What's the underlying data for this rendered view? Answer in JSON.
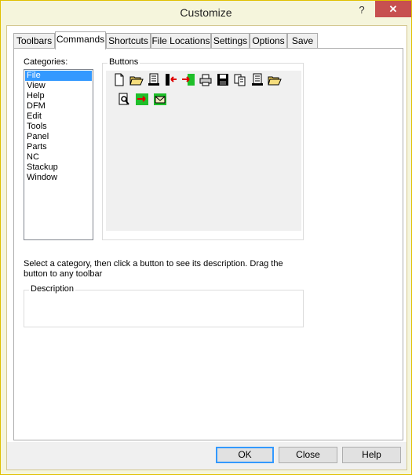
{
  "window": {
    "title": "Customize",
    "help_glyph": "?",
    "close_glyph": "✕"
  },
  "tabs": [
    {
      "label": "Toolbars"
    },
    {
      "label": "Commands",
      "active": true
    },
    {
      "label": "Shortcuts"
    },
    {
      "label": "File Locations"
    },
    {
      "label": "Settings"
    },
    {
      "label": "Options"
    },
    {
      "label": "Save"
    }
  ],
  "categories": {
    "label": "Categories:",
    "items": [
      "File",
      "View",
      "Help",
      "DFM",
      "Edit",
      "Tools",
      "Panel",
      "Parts",
      "NC",
      "Stackup",
      "Window"
    ],
    "selected": "File"
  },
  "buttons_group": {
    "label": "Buttons",
    "icons": [
      "new-file-icon",
      "open-folder-icon",
      "document-icon",
      "exit-icon",
      "import-icon",
      "print-icon",
      "save-icon",
      "copy-files-icon",
      "document-icon",
      "open-folder-icon",
      "print-preview-icon",
      "import-icon",
      "export-mail-icon"
    ]
  },
  "hint": "Select a category, then click a button to see its description. Drag the button to any toolbar",
  "description": {
    "label": "Description",
    "text": ""
  },
  "footer": {
    "ok": "OK",
    "close": "Close",
    "help": "Help"
  }
}
